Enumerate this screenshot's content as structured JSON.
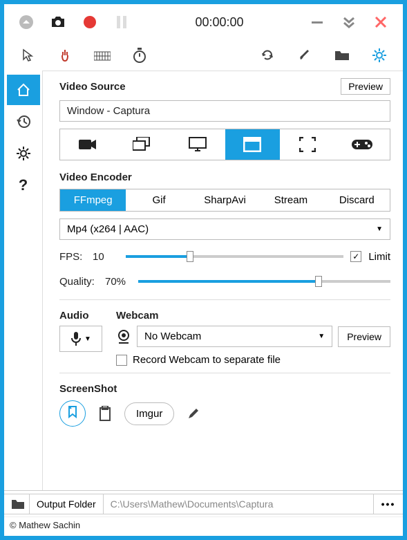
{
  "timer": "00:00:00",
  "videoSource": {
    "title": "Video Source",
    "previewBtn": "Preview",
    "value": "Window - Captura"
  },
  "videoEncoder": {
    "title": "Video Encoder",
    "tabs": [
      "FFmpeg",
      "Gif",
      "SharpAvi",
      "Stream",
      "Discard"
    ],
    "selected": "Mp4 (x264 | AAC)",
    "fpsLabel": "FPS:",
    "fpsValue": "10",
    "limitLabel": "Limit",
    "limitChecked": true,
    "qualityLabel": "Quality:",
    "qualityValue": "70%"
  },
  "audio": {
    "title": "Audio"
  },
  "webcam": {
    "title": "Webcam",
    "value": "No Webcam",
    "previewBtn": "Preview",
    "recordSeparateLabel": "Record Webcam to separate file"
  },
  "screenshot": {
    "title": "ScreenShot",
    "imgurBtn": "Imgur"
  },
  "output": {
    "label": "Output Folder",
    "path": "C:\\Users\\Mathew\\Documents\\Captura"
  },
  "credit": "© Mathew Sachin",
  "colors": {
    "accent": "#1a9fe0"
  }
}
